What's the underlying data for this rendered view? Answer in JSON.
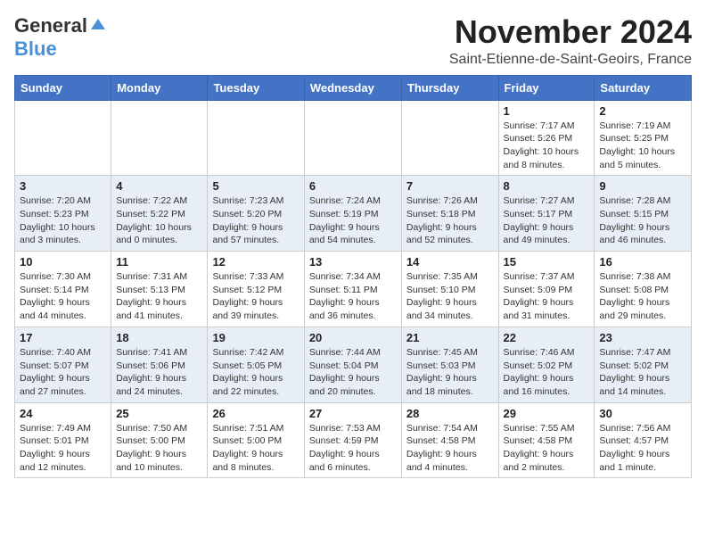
{
  "header": {
    "logo_general": "General",
    "logo_blue": "Blue",
    "month_title": "November 2024",
    "location": "Saint-Etienne-de-Saint-Geoirs, France"
  },
  "days_of_week": [
    "Sunday",
    "Monday",
    "Tuesday",
    "Wednesday",
    "Thursday",
    "Friday",
    "Saturday"
  ],
  "weeks": [
    [
      {
        "day": "",
        "info": ""
      },
      {
        "day": "",
        "info": ""
      },
      {
        "day": "",
        "info": ""
      },
      {
        "day": "",
        "info": ""
      },
      {
        "day": "",
        "info": ""
      },
      {
        "day": "1",
        "info": "Sunrise: 7:17 AM\nSunset: 5:26 PM\nDaylight: 10 hours and 8 minutes."
      },
      {
        "day": "2",
        "info": "Sunrise: 7:19 AM\nSunset: 5:25 PM\nDaylight: 10 hours and 5 minutes."
      }
    ],
    [
      {
        "day": "3",
        "info": "Sunrise: 7:20 AM\nSunset: 5:23 PM\nDaylight: 10 hours and 3 minutes."
      },
      {
        "day": "4",
        "info": "Sunrise: 7:22 AM\nSunset: 5:22 PM\nDaylight: 10 hours and 0 minutes."
      },
      {
        "day": "5",
        "info": "Sunrise: 7:23 AM\nSunset: 5:20 PM\nDaylight: 9 hours and 57 minutes."
      },
      {
        "day": "6",
        "info": "Sunrise: 7:24 AM\nSunset: 5:19 PM\nDaylight: 9 hours and 54 minutes."
      },
      {
        "day": "7",
        "info": "Sunrise: 7:26 AM\nSunset: 5:18 PM\nDaylight: 9 hours and 52 minutes."
      },
      {
        "day": "8",
        "info": "Sunrise: 7:27 AM\nSunset: 5:17 PM\nDaylight: 9 hours and 49 minutes."
      },
      {
        "day": "9",
        "info": "Sunrise: 7:28 AM\nSunset: 5:15 PM\nDaylight: 9 hours and 46 minutes."
      }
    ],
    [
      {
        "day": "10",
        "info": "Sunrise: 7:30 AM\nSunset: 5:14 PM\nDaylight: 9 hours and 44 minutes."
      },
      {
        "day": "11",
        "info": "Sunrise: 7:31 AM\nSunset: 5:13 PM\nDaylight: 9 hours and 41 minutes."
      },
      {
        "day": "12",
        "info": "Sunrise: 7:33 AM\nSunset: 5:12 PM\nDaylight: 9 hours and 39 minutes."
      },
      {
        "day": "13",
        "info": "Sunrise: 7:34 AM\nSunset: 5:11 PM\nDaylight: 9 hours and 36 minutes."
      },
      {
        "day": "14",
        "info": "Sunrise: 7:35 AM\nSunset: 5:10 PM\nDaylight: 9 hours and 34 minutes."
      },
      {
        "day": "15",
        "info": "Sunrise: 7:37 AM\nSunset: 5:09 PM\nDaylight: 9 hours and 31 minutes."
      },
      {
        "day": "16",
        "info": "Sunrise: 7:38 AM\nSunset: 5:08 PM\nDaylight: 9 hours and 29 minutes."
      }
    ],
    [
      {
        "day": "17",
        "info": "Sunrise: 7:40 AM\nSunset: 5:07 PM\nDaylight: 9 hours and 27 minutes."
      },
      {
        "day": "18",
        "info": "Sunrise: 7:41 AM\nSunset: 5:06 PM\nDaylight: 9 hours and 24 minutes."
      },
      {
        "day": "19",
        "info": "Sunrise: 7:42 AM\nSunset: 5:05 PM\nDaylight: 9 hours and 22 minutes."
      },
      {
        "day": "20",
        "info": "Sunrise: 7:44 AM\nSunset: 5:04 PM\nDaylight: 9 hours and 20 minutes."
      },
      {
        "day": "21",
        "info": "Sunrise: 7:45 AM\nSunset: 5:03 PM\nDaylight: 9 hours and 18 minutes."
      },
      {
        "day": "22",
        "info": "Sunrise: 7:46 AM\nSunset: 5:02 PM\nDaylight: 9 hours and 16 minutes."
      },
      {
        "day": "23",
        "info": "Sunrise: 7:47 AM\nSunset: 5:02 PM\nDaylight: 9 hours and 14 minutes."
      }
    ],
    [
      {
        "day": "24",
        "info": "Sunrise: 7:49 AM\nSunset: 5:01 PM\nDaylight: 9 hours and 12 minutes."
      },
      {
        "day": "25",
        "info": "Sunrise: 7:50 AM\nSunset: 5:00 PM\nDaylight: 9 hours and 10 minutes."
      },
      {
        "day": "26",
        "info": "Sunrise: 7:51 AM\nSunset: 5:00 PM\nDaylight: 9 hours and 8 minutes."
      },
      {
        "day": "27",
        "info": "Sunrise: 7:53 AM\nSunset: 4:59 PM\nDaylight: 9 hours and 6 minutes."
      },
      {
        "day": "28",
        "info": "Sunrise: 7:54 AM\nSunset: 4:58 PM\nDaylight: 9 hours and 4 minutes."
      },
      {
        "day": "29",
        "info": "Sunrise: 7:55 AM\nSunset: 4:58 PM\nDaylight: 9 hours and 2 minutes."
      },
      {
        "day": "30",
        "info": "Sunrise: 7:56 AM\nSunset: 4:57 PM\nDaylight: 9 hours and 1 minute."
      }
    ]
  ]
}
